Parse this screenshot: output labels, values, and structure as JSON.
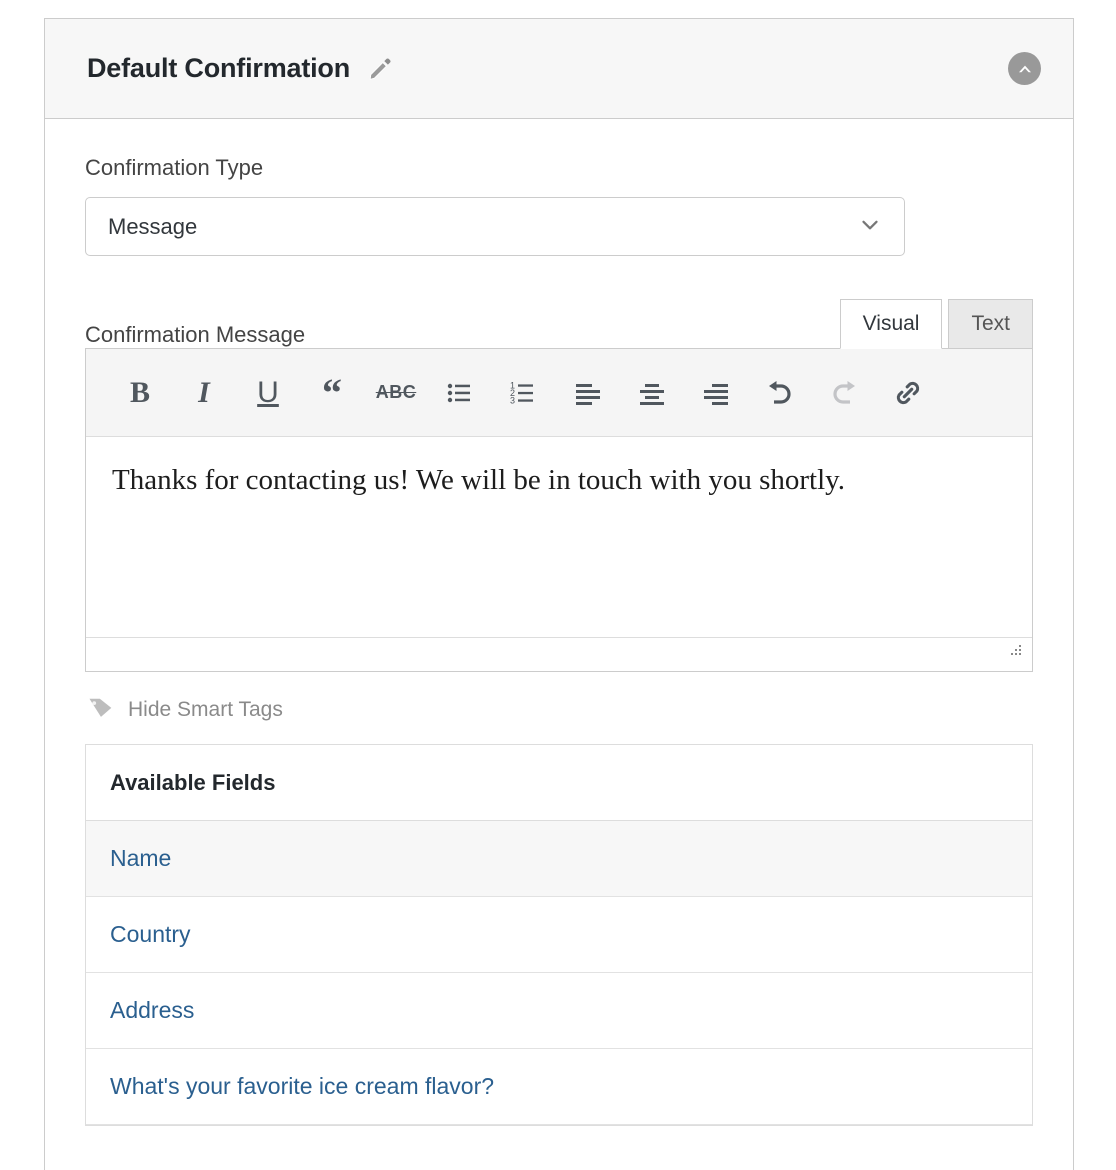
{
  "panel": {
    "title": "Default Confirmation",
    "edit_icon": "pencil-icon",
    "collapse_icon": "chevron-up-circle-icon"
  },
  "confirmation_type": {
    "label": "Confirmation Type",
    "selected": "Message",
    "chevron_icon": "chevron-down-icon"
  },
  "confirmation_message": {
    "label": "Confirmation Message",
    "tabs": [
      {
        "label": "Visual",
        "active": true
      },
      {
        "label": "Text",
        "active": false
      }
    ],
    "toolbar": [
      {
        "name": "bold-icon",
        "glyph": "B",
        "enabled": true
      },
      {
        "name": "italic-icon",
        "glyph": "I",
        "enabled": true
      },
      {
        "name": "underline-icon",
        "glyph": "U",
        "enabled": true
      },
      {
        "name": "blockquote-icon",
        "glyph": "“",
        "enabled": true
      },
      {
        "name": "strikethrough-icon",
        "glyph": "ABC",
        "enabled": true
      },
      {
        "name": "bulleted-list-icon",
        "glyph": "",
        "enabled": true
      },
      {
        "name": "numbered-list-icon",
        "glyph": "",
        "enabled": true
      },
      {
        "name": "align-left-icon",
        "glyph": "",
        "enabled": true
      },
      {
        "name": "align-center-icon",
        "glyph": "",
        "enabled": true
      },
      {
        "name": "align-right-icon",
        "glyph": "",
        "enabled": true
      },
      {
        "name": "undo-icon",
        "glyph": "",
        "enabled": true
      },
      {
        "name": "redo-icon",
        "glyph": "",
        "enabled": false
      },
      {
        "name": "link-icon",
        "glyph": "",
        "enabled": true
      }
    ],
    "content": "Thanks for contacting us! We will be in touch with you shortly.",
    "resize_grip_icon": "resize-grip-icon"
  },
  "smart_tags": {
    "icon": "tag-icon",
    "label": "Hide Smart Tags"
  },
  "available_fields": {
    "header": "Available Fields",
    "rows": [
      {
        "label": "Name",
        "striped": true
      },
      {
        "label": "Country",
        "striped": false
      },
      {
        "label": "Address",
        "striped": false
      },
      {
        "label": "What's your favorite ice cream flavor?",
        "striped": false
      }
    ]
  },
  "colors": {
    "link": "#2a5f8f",
    "panel_border": "#cccccc",
    "header_bg": "#f7f7f7",
    "toolbar_bg": "#f5f5f5",
    "muted_text": "#8a8a8a"
  }
}
